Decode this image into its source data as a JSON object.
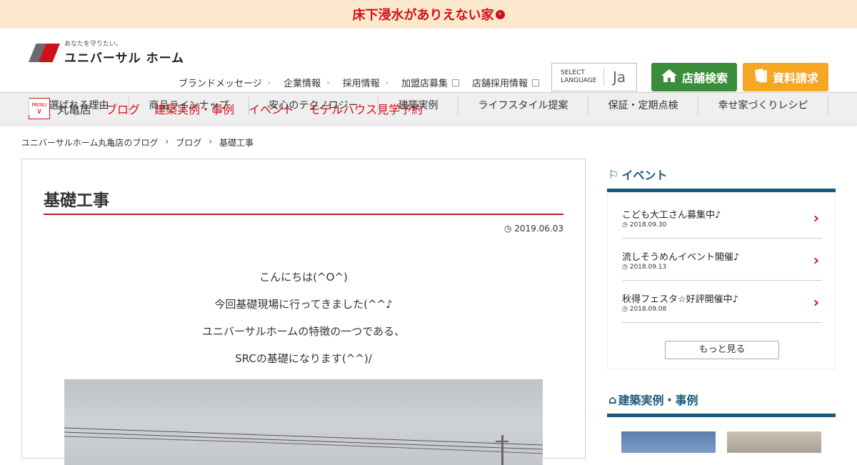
{
  "banner": {
    "text": "床下浸水がありえない家"
  },
  "logo": {
    "tagline": "あなたを守りたい。",
    "name": "ユニバーサル ホーム"
  },
  "util_nav": [
    {
      "label": "ブランドメッセージ",
      "icon": "chevron-right-icon"
    },
    {
      "label": "企業情報",
      "icon": "chevron-right-icon"
    },
    {
      "label": "採用情報",
      "icon": "chevron-right-icon"
    },
    {
      "label": "加盟店募集",
      "icon": "external-link-icon"
    },
    {
      "label": "店舗採用情報",
      "icon": "external-link-icon"
    }
  ],
  "language": {
    "label_line1": "SELECT",
    "label_line2": "LANGUAGE",
    "current": "Ja"
  },
  "buttons": {
    "store_search": "店舗検索",
    "request_docs": "資料請求"
  },
  "main_nav": [
    "選ばれる理由",
    "商品ラインナップ",
    "安心のテクノロジー",
    "建築実例",
    "ライフスタイル提案",
    "保証・定期点検",
    "幸せ家づくりレシピ"
  ],
  "subnav": {
    "menu_label": "MENU",
    "store": "丸亀店",
    "links": [
      "ブログ",
      "建築実例・事例",
      "イベント",
      "モデルハウス見学予約"
    ]
  },
  "breadcrumb": [
    "ユニバーサルホーム丸亀店のブログ",
    "ブログ",
    "基礎工事"
  ],
  "article": {
    "title": "基礎工事",
    "date": "2019.06.03",
    "paragraphs": [
      "こんにちは(^O^)",
      "今回基礎現場に行ってきました(^^♪",
      "ユニバーサルホームの特徴の一つである、",
      "SRCの基礎になります(^^)/"
    ]
  },
  "sidebar": {
    "events_title": "イベント",
    "events": [
      {
        "title": "こども大工さん募集中♪",
        "date": "2018.09.30"
      },
      {
        "title": "流しそうめんイベント開催♪",
        "date": "2018.09.13"
      },
      {
        "title": "秋得フェスタ☆好評開催中♪",
        "date": "2018.09.08"
      }
    ],
    "more_label": "もっと見る",
    "works_title": "建築実例・事例"
  },
  "colors": {
    "brand_red": "#d0101a",
    "green": "#3a8e3a",
    "orange": "#f5a623",
    "navy": "#1c5a7a",
    "banner_bg": "#fce8cc"
  }
}
